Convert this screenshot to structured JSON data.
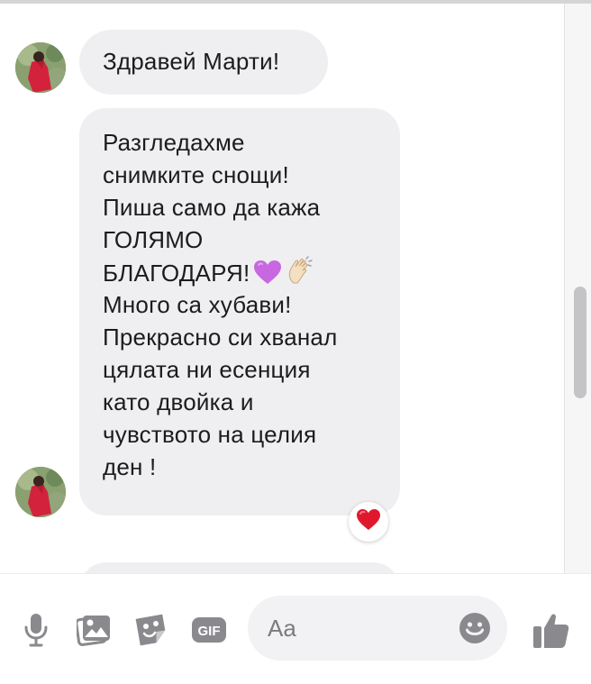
{
  "conversation": {
    "messages": [
      {
        "lines": [
          "Здравей Марти!"
        ]
      },
      {
        "lines": [
          "Разгледахме",
          "снимките снощи!",
          "Пиша само да кажа",
          "ГОЛЯМО",
          "БЛАГОДАРЯ!",
          "Много са хубави!",
          "Прекрасно си хванал",
          "цялата ни есенция",
          "като двойка и",
          "чувството на целия",
          "ден !"
        ],
        "inline_emojis": [
          "purple-heart",
          "clapping-hands"
        ],
        "reaction": "red-heart"
      }
    ]
  },
  "composer": {
    "tools": [
      "microphone-icon",
      "photo-icon",
      "sticker-icon",
      "gif-icon"
    ],
    "gif_label": "GIF",
    "input_placeholder": "Aa",
    "emoji_icon": "smiley-icon",
    "send_icon": "thumbs-up-icon"
  },
  "colors": {
    "bubble": "#efeff1",
    "text": "#1c1c1e",
    "icon": "#8a8a8e",
    "reaction_heart": "#e0182d",
    "purple_heart": "#c867e0"
  }
}
